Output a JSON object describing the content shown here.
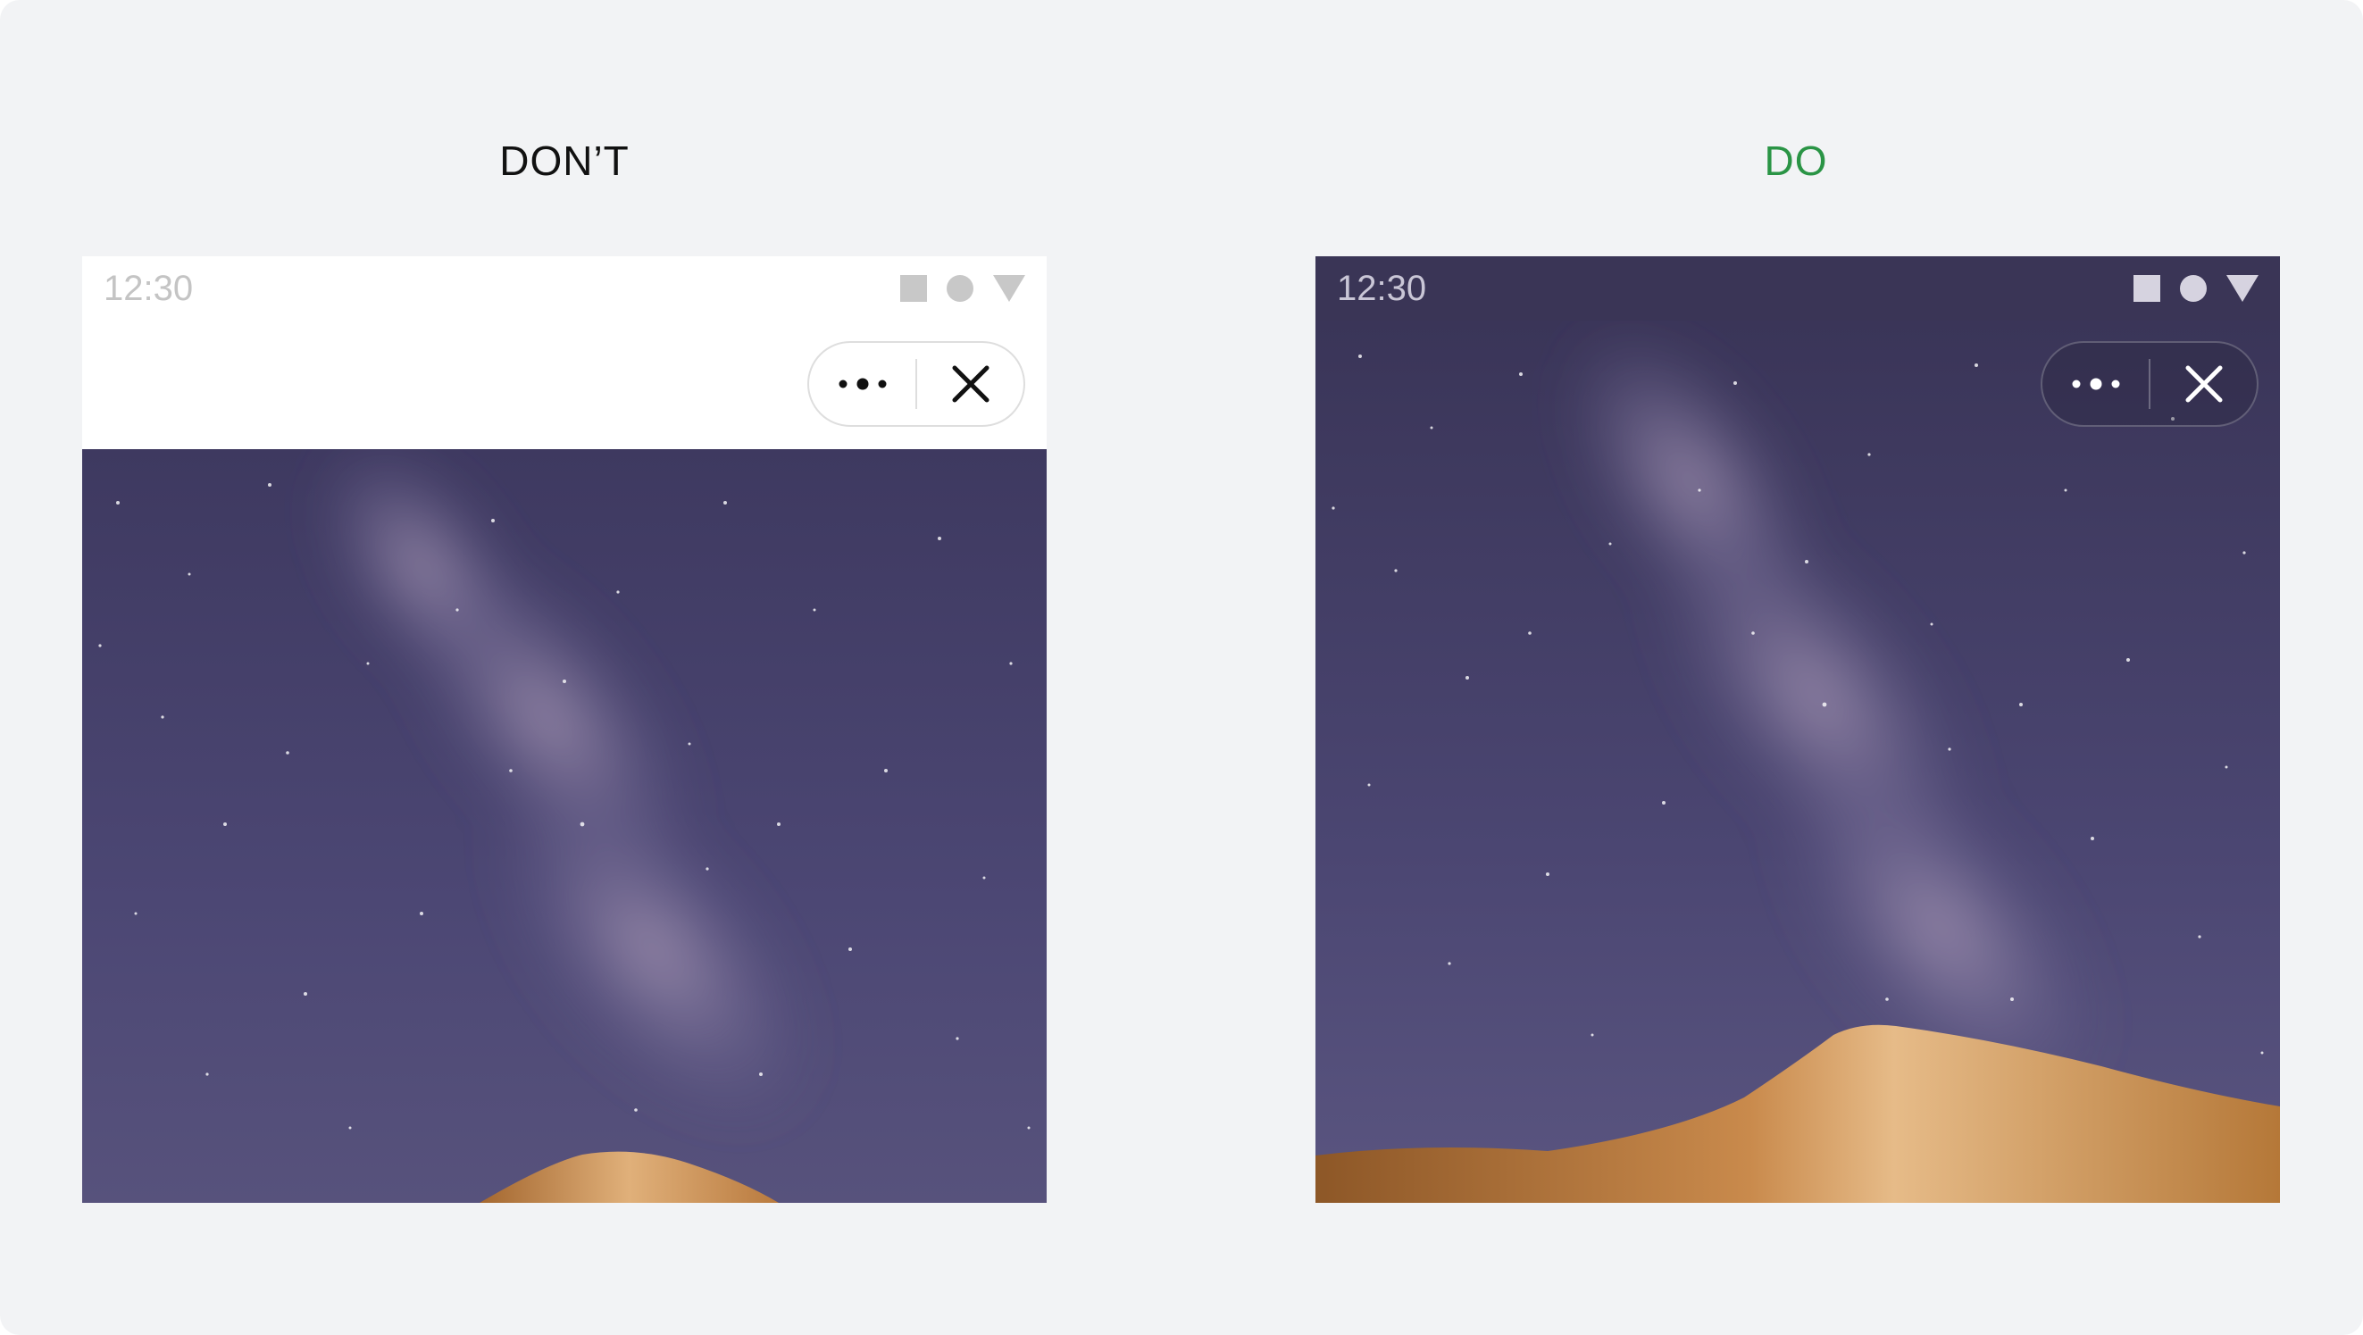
{
  "columns": [
    {
      "heading": "DON’T",
      "heading_color": "#111111",
      "status_bar": {
        "time": "12:30",
        "background": "#ffffff"
      },
      "capsule": {
        "more_icon": "more-dots-icon",
        "close_icon": "close-icon"
      }
    },
    {
      "heading": "DO",
      "heading_color": "#2a9445",
      "status_bar": {
        "time": "12:30",
        "background": "#3a3556"
      },
      "capsule": {
        "more_icon": "more-dots-icon",
        "close_icon": "close-icon"
      }
    }
  ],
  "colors": {
    "page_background": "#f2f3f5",
    "sky": "#4a4670",
    "dune": "#c98a4c",
    "do_accent": "#2a9445"
  }
}
